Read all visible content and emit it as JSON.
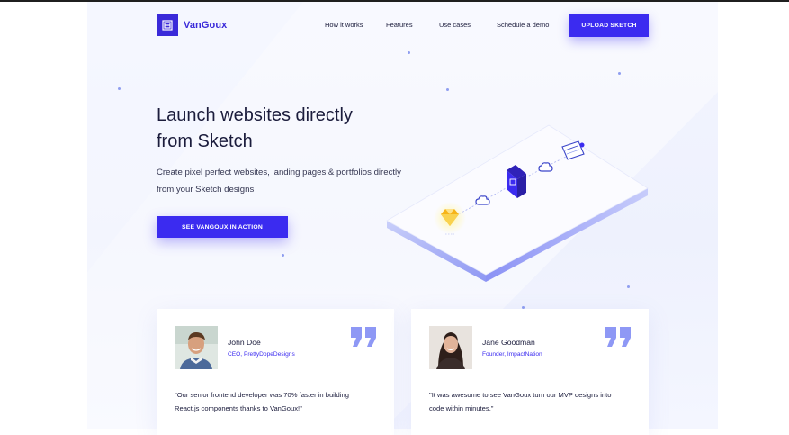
{
  "brand": {
    "name": "VanGoux",
    "logo_icon": "vangoux-logo-icon"
  },
  "nav": {
    "items": [
      "How it works",
      "Features",
      "Use cases",
      "Schedule a demo"
    ],
    "upload_label": "UPLOAD SKETCH"
  },
  "hero": {
    "title_lines": [
      "Launch websites directly",
      "from Sketch"
    ],
    "subtitle_lines": [
      "Create pixel perfect websites, landing pages & portfolios directly",
      "from your Sketch designs"
    ],
    "cta_label": "SEE VANGOUX IN ACTION"
  },
  "illustration": {
    "icons": [
      "sketch-diamond-icon",
      "cloud-icon",
      "vangoux-logo-icon",
      "cloud-icon",
      "browser-window-icon"
    ]
  },
  "testimonials": [
    {
      "name": "John Doe",
      "role": "CEO, PrettyDopeDesigns",
      "quote_lines": [
        "\"Our senior frontend developer was 70% faster in building",
        "React.js components thanks to VanGoux!\""
      ]
    },
    {
      "name": "Jane Goodman",
      "role": "Founder, ImpactNation",
      "quote_lines": [
        "\"It was awesome to see VanGoux turn our MVP designs into",
        "code within minutes.\""
      ]
    }
  ],
  "colors": {
    "accent": "#3b2bf0",
    "text": "#1b1c3c",
    "background": "#f1f3fe"
  }
}
